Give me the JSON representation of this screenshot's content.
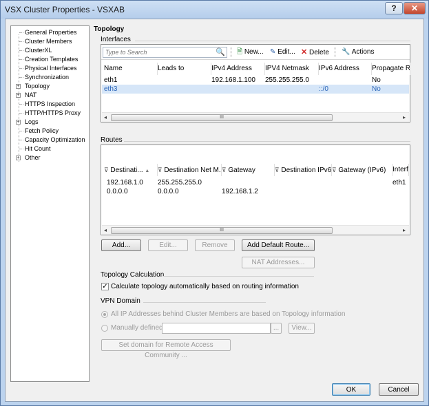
{
  "window": {
    "title": "VSX Cluster Properties - VSXAB"
  },
  "titlebar": {
    "help": "?",
    "close": "✕"
  },
  "tree": {
    "items": [
      {
        "label": "General Properties",
        "expandable": false
      },
      {
        "label": "Cluster Members",
        "expandable": false
      },
      {
        "label": "ClusterXL",
        "expandable": false
      },
      {
        "label": "Creation Templates",
        "expandable": false
      },
      {
        "label": "Physical Interfaces",
        "expandable": false
      },
      {
        "label": "Synchronization",
        "expandable": false
      },
      {
        "label": "Topology",
        "expandable": true
      },
      {
        "label": "NAT",
        "expandable": true
      },
      {
        "label": "HTTPS Inspection",
        "expandable": false
      },
      {
        "label": "HTTP/HTTPS Proxy",
        "expandable": false
      },
      {
        "label": "Logs",
        "expandable": true
      },
      {
        "label": "Fetch Policy",
        "expandable": false
      },
      {
        "label": "Capacity Optimization",
        "expandable": false
      },
      {
        "label": "Hit Count",
        "expandable": false
      },
      {
        "label": "Other",
        "expandable": true
      }
    ]
  },
  "page": {
    "title": "Topology"
  },
  "interfaces": {
    "title": "Interfaces",
    "search_placeholder": "Type to Search",
    "toolbar": {
      "new": "New...",
      "edit": "Edit...",
      "delete": "Delete",
      "actions": "Actions"
    },
    "columns": [
      "Name",
      "Leads to",
      "IPv4 Address",
      "IPV4 Netmask",
      "IPv6 Address",
      "Propagate Ro"
    ],
    "rows": [
      [
        "eth1",
        "",
        "192.168.1.100",
        "255.255.255.0",
        "",
        "No"
      ],
      [
        "eth3",
        "",
        "",
        "",
        "::/0",
        "No"
      ]
    ],
    "selected_row": 1
  },
  "routes": {
    "title": "Routes",
    "columns": [
      "Destinati...",
      "Destination Net M...",
      "Gateway",
      "Destination IPv6",
      "Gateway (IPv6)",
      "Interfa"
    ],
    "rows": [
      [
        "192.168.1.0",
        "255.255.255.0",
        "",
        "",
        "",
        "eth1"
      ],
      [
        "0.0.0.0",
        "0.0.0.0",
        "192.168.1.2",
        "",
        "",
        ""
      ]
    ],
    "buttons": {
      "add": "Add...",
      "edit": "Edit...",
      "remove": "Remove",
      "add_default": "Add Default Route...",
      "nat": "NAT Addresses..."
    }
  },
  "topology_calc": {
    "title": "Topology Calculation",
    "checkbox_label": "Calculate topology automatically based on routing information",
    "checked": true
  },
  "vpn": {
    "title": "VPN Domain",
    "option_all": "All IP Addresses behind Cluster Members are based on Topology information",
    "option_manual": "Manually defined",
    "browse": "...",
    "view": "View...",
    "remote_access": "Set domain for Remote Access Community ..."
  },
  "footer": {
    "ok": "OK",
    "cancel": "Cancel"
  },
  "scroll": {
    "thumb_grip": "III",
    "left_arrow": "◂",
    "right_arrow": "▸"
  },
  "glyphs": {
    "search": "🔍",
    "new": "🗎",
    "edit": "✎",
    "delete": "✕",
    "actions": "🔧",
    "filter": "⊽",
    "sort": "▲",
    "expand": "+",
    "check": "✓"
  }
}
